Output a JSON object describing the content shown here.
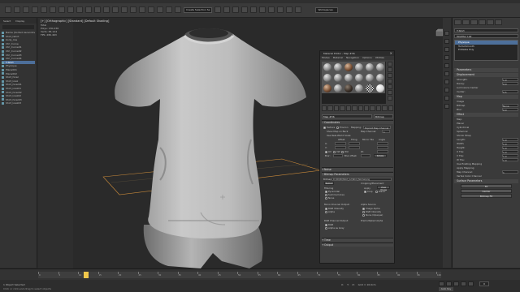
{
  "viewport": {
    "label": "[+] [Orthographic] [Standard] [Default Shading]",
    "stats": [
      {
        "label": "Total",
        "value": ""
      },
      {
        "label": "Polys:",
        "value": "130,236"
      },
      {
        "label": "Verts:",
        "value": "65,124"
      },
      {
        "label": "FPS:",
        "value": "280.463"
      }
    ]
  },
  "scene_explorer": {
    "tabs": [
      "Select",
      "Display"
    ],
    "items": [
      {
        "label": "Name (Sorted Ascending)",
        "selected": false
      },
      {
        "label": "Shirt_tshirt",
        "selected": false
      },
      {
        "label": "body_low",
        "selected": false
      },
      {
        "label": "Ctrl_Curve",
        "selected": false
      },
      {
        "label": "Ctrl_Curve01",
        "selected": false
      },
      {
        "label": "Ctrl_Curve02",
        "selected": false
      },
      {
        "label": "Ctrl_Curve03",
        "selected": false
      },
      {
        "label": "Ctrl_Curve04",
        "selected": false
      },
      {
        "label": "T-Shirt",
        "selected": true
      },
      {
        "label": "Physique",
        "selected": false
      },
      {
        "label": "Plane001",
        "selected": false
      },
      {
        "label": "Plane002",
        "selected": false
      },
      {
        "label": "Shirt_hirez",
        "selected": false
      },
      {
        "label": "Shirt_lowz",
        "selected": false
      },
      {
        "label": "Shirt_hirez01",
        "selected": false
      },
      {
        "label": "Shirt_lowz01",
        "selected": false
      },
      {
        "label": "Shirt_hirez02",
        "selected": false
      },
      {
        "label": "Shirt_lowz02",
        "selected": false
      },
      {
        "label": "Shirt_hirez03",
        "selected": false
      },
      {
        "label": "Shirt_lowz03",
        "selected": false
      }
    ]
  },
  "toolbar": {
    "workspace": "Workspaces:",
    "selection_set": "Create Selection Se"
  },
  "material_editor": {
    "title": "Material Editor - Map #36",
    "menu": [
      "Modes",
      "Material",
      "Navigation",
      "Options",
      "Utilities"
    ],
    "slots": [
      "grey",
      "grey",
      "brown",
      "grey",
      "grey",
      "grey",
      "grey",
      "grey",
      "grey",
      "grey",
      "grey",
      "grey",
      "brown",
      "grey",
      "dark",
      "grey",
      "check",
      "white"
    ],
    "map_name_label": "Map #36",
    "map_type": "Bitmap",
    "rollouts": {
      "coordinates": "Coordinates",
      "noise": "Noise",
      "bitmap_params": "Bitmap Parameters",
      "time": "Time",
      "output": "Output"
    },
    "coords": {
      "texture": "Texture",
      "environ": "Environ",
      "mapping": "Mapping:",
      "mapping_value": "Explicit Map Channel",
      "show_map_back": "Show Map on Back",
      "map_channel": "Map Channel:",
      "map_channel_value": "1",
      "real_world": "Use Real-World Scale",
      "offset": "Offset",
      "tiling": "Tiling",
      "mirror_tile": "Mirror Tile",
      "angle": "Angle",
      "u": "U:",
      "v": "V:",
      "w": "W:",
      "uv": "UV",
      "vw": "VW",
      "wu": "WU",
      "blur": "Blur:",
      "blur_offset": "Blur offset:",
      "rotate": "Rotate"
    },
    "bitmap": {
      "bitmap_label": "Bitmap:",
      "path": "D:\\3D\\3D\\Tshirt_Uv\\Tshirt_Normal.png",
      "reload": "Reload",
      "filtering": "Filtering",
      "pyramidal": "Pyramidal",
      "summed_area": "Summed Area",
      "none": "None",
      "mono_output": "Mono Channel Output:",
      "rgb_intensity": "RGB Intensity",
      "alpha": "Alpha",
      "rgb_output": "RGB Channel Output:",
      "rgb": "RGB",
      "alpha_gray": "Alpha as Gray",
      "cropping": "Cropping/Placement",
      "apply": "Apply",
      "view_image": "View Image",
      "crop": "Crop",
      "place": "Place",
      "alpha_source": "Alpha Source",
      "image_alpha": "Image Alpha",
      "rgb_int": "RGB Intensity",
      "none_opaque": "None (Opaque)",
      "premult": "Premultiplied Alpha"
    }
  },
  "command_panel": {
    "object_name": "T-Shirt",
    "modifier_list_label": "Modifier List",
    "modifiers": [
      {
        "label": "Physique",
        "selected": true
      },
      {
        "label": "TurboSmooth",
        "selected": false
      },
      {
        "label": "Editable Poly",
        "selected": false
      }
    ],
    "rollouts": [
      "Parameters",
      "Displacement",
      "Map",
      "Effect",
      "Surface Parameters",
      "Lock To Viewport",
      "Channel",
      "Alignment"
    ],
    "params": [
      {
        "label": "Strength:",
        "value": "1.0"
      },
      {
        "label": "Decay:",
        "value": "0.0"
      },
      {
        "label": "Luminance Center",
        "value": ""
      },
      {
        "label": "Center:",
        "value": "0.5"
      },
      {
        "label": "Image",
        "value": ""
      },
      {
        "label": "Bitmap",
        "value": "None"
      },
      {
        "label": "Blur:",
        "value": "0.0"
      },
      {
        "label": "Map:",
        "value": ""
      },
      {
        "label": "Planar",
        "value": ""
      },
      {
        "label": "Cylindrical",
        "value": ""
      },
      {
        "label": "Spherical",
        "value": ""
      },
      {
        "label": "Shrink Wrap",
        "value": ""
      },
      {
        "label": "Length:",
        "value": "1.0"
      },
      {
        "label": "Width:",
        "value": "1.0"
      },
      {
        "label": "Height:",
        "value": "1.0"
      },
      {
        "label": "U Tile:",
        "value": "1.0"
      },
      {
        "label": "V Tile:",
        "value": "1.0"
      },
      {
        "label": "W Tile:",
        "value": "1.0"
      },
      {
        "label": "Use Existing Mapping",
        "value": ""
      },
      {
        "label": "Apply Mapping",
        "value": ""
      },
      {
        "label": "Map Channel:",
        "value": "1"
      },
      {
        "label": "Vertex Color Channel",
        "value": ""
      }
    ],
    "buttons": [
      "Fit",
      "Center",
      "Bitmap Fit",
      "Normal Align",
      "View Align",
      "Region Fit",
      "Reset",
      "Acquire"
    ]
  },
  "timeline": {
    "frame_display": "0 / 100",
    "ticks": [
      "0",
      "5",
      "10",
      "15",
      "20",
      "25",
      "30",
      "35",
      "40",
      "45",
      "50",
      "55",
      "60",
      "65",
      "70",
      "75",
      "80",
      "85",
      "90",
      "95",
      "100"
    ]
  },
  "status": {
    "selection": "1 Object Selected",
    "message": "Click or click-and-drag to select objects",
    "x": "X:",
    "y": "Y:",
    "z": "Z:",
    "grid": "Grid = 10.0cm",
    "autokey": "Auto Key",
    "selected": "Selected",
    "current_frame": "0"
  }
}
